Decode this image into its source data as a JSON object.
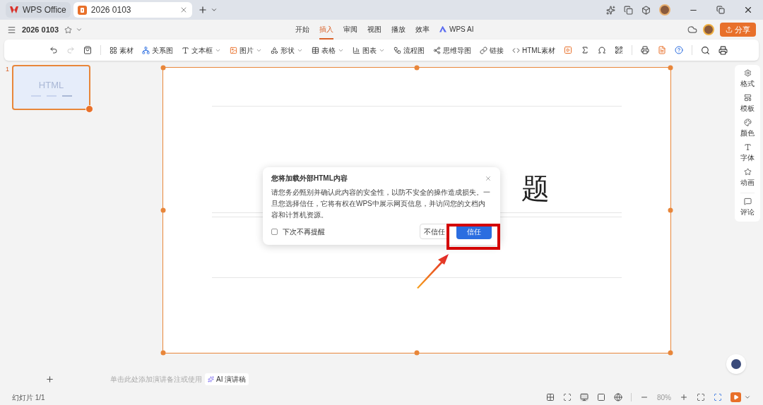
{
  "tabs": [
    {
      "label": "WPS Office",
      "selected": false,
      "kind": "home"
    },
    {
      "label": "2026 0103",
      "selected": true,
      "kind": "doc"
    }
  ],
  "document_title": "2026 0103",
  "menu": [
    {
      "label": "开始",
      "selected": false
    },
    {
      "label": "插入",
      "selected": true
    },
    {
      "label": "审阅",
      "selected": false
    },
    {
      "label": "视图",
      "selected": false
    },
    {
      "label": "播放",
      "selected": false
    },
    {
      "label": "效率",
      "selected": false
    },
    {
      "label": "WPS AI",
      "selected": false
    }
  ],
  "share_button": "分享",
  "history": [
    {
      "disabled": false
    },
    {
      "disabled": true
    }
  ],
  "toolbar": [
    {
      "label": "素材",
      "dropdown": false
    },
    {
      "label": "关系图",
      "dropdown": false
    },
    {
      "label": "文本框",
      "dropdown": true
    },
    {
      "label": "图片",
      "dropdown": true
    },
    {
      "label": "形状",
      "dropdown": true
    },
    {
      "label": "表格",
      "dropdown": true
    },
    {
      "label": "图表",
      "dropdown": true
    },
    {
      "label": "流程图",
      "dropdown": false
    },
    {
      "label": "思维导图",
      "dropdown": false
    },
    {
      "label": "链接",
      "dropdown": false
    },
    {
      "label": "HTML素材",
      "dropdown": false
    }
  ],
  "thumbnail": {
    "number": "1",
    "text": "HTML",
    "selected": true
  },
  "slide": {
    "title_visible": "题"
  },
  "dialog": {
    "title": "您将加载外部HTML内容",
    "body": "请您务必甄别并确认此内容的安全性，以防不安全的操作造成损失。一旦您选择信任，它将有权在WPS中展示网页信息，并访问您的文档内容和计算机资源。",
    "checkbox": {
      "label": "下次不再提醒",
      "checked": false
    },
    "buttons": [
      {
        "label": "不信任",
        "kind": "secondary"
      },
      {
        "label": "信任",
        "kind": "primary"
      }
    ]
  },
  "right_panel": [
    "格式",
    "模板",
    "颜色",
    "字体",
    "动画",
    "评论"
  ],
  "notes": {
    "placeholder": "单击此处添加演讲备注或使用",
    "ai_button": "AI 演讲稿"
  },
  "status_bar": {
    "slide_count": "幻灯片 1/1",
    "zoom": "80%"
  }
}
